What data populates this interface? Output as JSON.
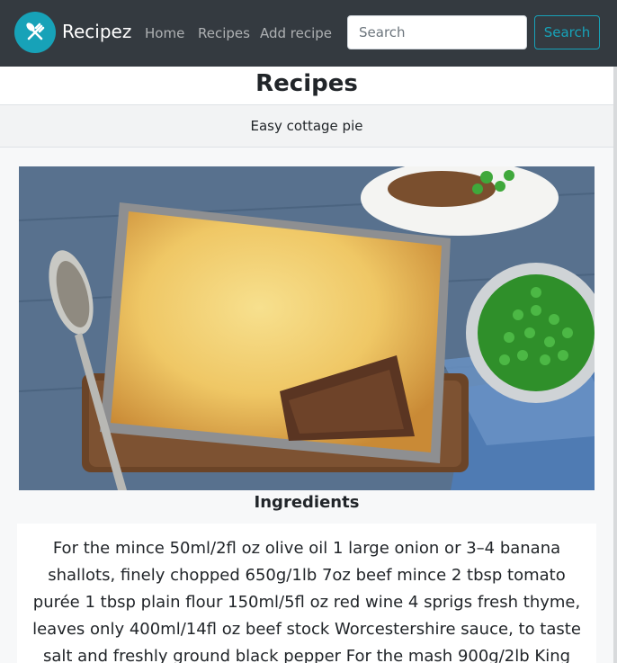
{
  "navbar": {
    "brand": "Recipez",
    "links": [
      "Home",
      "Recipes",
      "Add recipe"
    ],
    "search_placeholder": "Search",
    "search_button": "Search"
  },
  "page": {
    "title": "Recipes",
    "recipe_name": "Easy cottage pie",
    "image_alt": "Easy cottage pie",
    "ingredients_heading": "Ingredients",
    "ingredients_text": "For the mince 50ml/2fl oz olive oil 1 large onion or 3–4 banana shallots, finely chopped 650g/1lb 7oz beef mince 2 tbsp tomato purée 1 tbsp plain flour 150ml/5fl oz red wine 4 sprigs fresh thyme, leaves only 400ml/14fl oz beef stock Worcestershire sauce, to taste salt and freshly ground black pepper For the mash 900g/2lb King"
  },
  "colors": {
    "navbar": "#343a40",
    "accent": "#17a2b8"
  },
  "icons": {
    "logo": "fork-knife-icon"
  }
}
